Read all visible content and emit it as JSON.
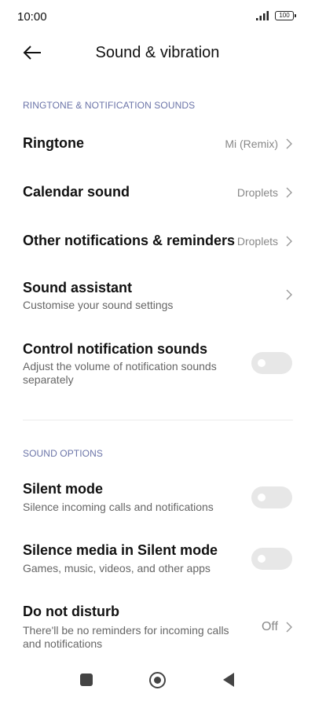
{
  "status_bar": {
    "time": "10:00",
    "battery": "100"
  },
  "header": {
    "title": "Sound & vibration",
    "back_icon": "arrow-left-icon"
  },
  "sections": {
    "ringtone_header": "RINGTONE & NOTIFICATION SOUNDS",
    "sound_options_header": "SOUND OPTIONS"
  },
  "rows": {
    "ringtone": {
      "title": "Ringtone",
      "value": "Mi (Remix)"
    },
    "calendar": {
      "title": "Calendar sound",
      "value": "Droplets"
    },
    "other_notifications": {
      "title": "Other notifications & reminders",
      "value": "Droplets"
    },
    "sound_assistant": {
      "title": "Sound assistant",
      "subtitle": "Customise your sound settings"
    },
    "control_notification": {
      "title": "Control notification sounds",
      "subtitle_1": "Adjust the volume of notification sounds",
      "subtitle_2": "separately",
      "enabled": false
    },
    "silent_mode": {
      "title": "Silent mode",
      "subtitle": "Silence incoming calls and notifications",
      "enabled": false
    },
    "silence_media": {
      "title": "Silence media in Silent mode",
      "subtitle": "Games, music, videos, and other apps",
      "enabled": false
    },
    "do_not_disturb": {
      "title": "Do not disturb",
      "subtitle_1": "There'll be no reminders for incoming calls",
      "subtitle_2": "and notifications",
      "value": "Off"
    }
  },
  "nav": {
    "recent_icon": "square-icon",
    "home_icon": "circle-icon",
    "back_icon": "triangle-back-icon"
  }
}
